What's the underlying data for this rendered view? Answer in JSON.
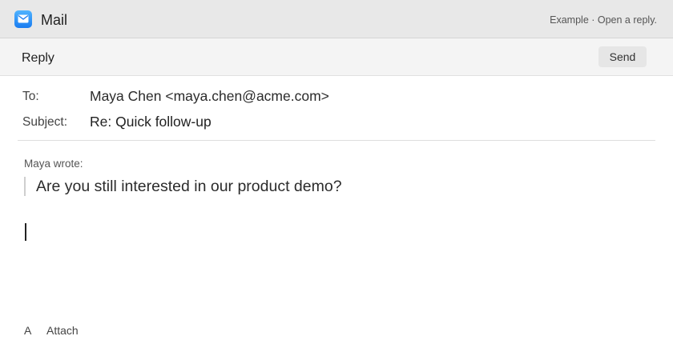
{
  "window": {
    "app_title": "Mail",
    "hint": "Example · Open a reply.",
    "app_icon": "mail-envelope-icon",
    "accent": "#1a7cf0"
  },
  "toolbar": {
    "title": "Reply",
    "send_label": "Send"
  },
  "header": {
    "to_label": "To:",
    "to_value": "Maya Chen <maya.chen@acme.com>",
    "subject_label": "Subject:",
    "subject_value": "Re: Quick follow-up"
  },
  "quote": {
    "attribution": "Maya wrote:",
    "text": "Are you still interested in our product demo?"
  },
  "compose": {
    "body": ""
  },
  "footer": {
    "format_label": "A",
    "attach_label": "Attach"
  }
}
